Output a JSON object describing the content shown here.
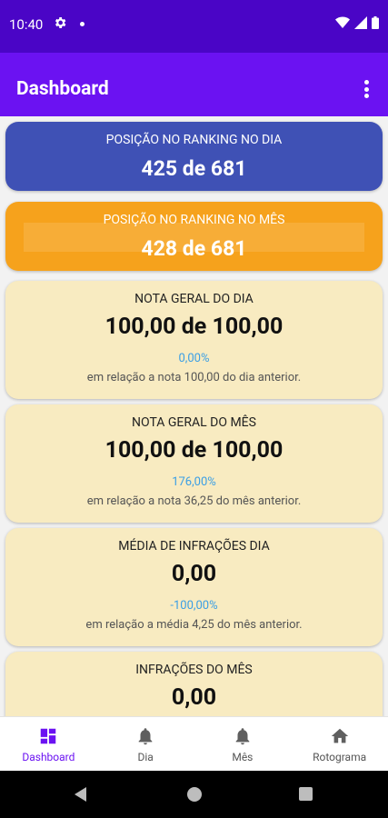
{
  "status_bar": {
    "time": "10:40"
  },
  "app_bar": {
    "title": "Dashboard"
  },
  "ranking_day": {
    "label": "POSIÇÃO NO RANKING NO DIA",
    "value": "425 de 681"
  },
  "ranking_month": {
    "label": "POSIÇÃO NO RANKING NO MÊS",
    "value": "428 de 681"
  },
  "cards": [
    {
      "label": "NOTA GERAL DO DIA",
      "value": "100,00 de 100,00",
      "percent": "0,00%",
      "note": "em relação a nota 100,00 do dia anterior."
    },
    {
      "label": "NOTA GERAL DO MÊS",
      "value": "100,00 de 100,00",
      "percent": "176,00%",
      "note": "em relação a nota 36,25 do mês anterior."
    },
    {
      "label": "MÉDIA DE INFRAÇÕES DIA",
      "value": "0,00",
      "percent": "-100,00%",
      "note": "em relação a média 4,25 do mês anterior."
    },
    {
      "label": "INFRAÇÕES DO MÊS",
      "value": "0,00"
    }
  ],
  "bottom_nav": [
    {
      "label": "Dashboard",
      "icon": "dashboard-icon",
      "active": true
    },
    {
      "label": "Dia",
      "icon": "bell-icon",
      "active": false
    },
    {
      "label": "Mês",
      "icon": "bell-icon",
      "active": false
    },
    {
      "label": "Rotograma",
      "icon": "home-icon",
      "active": false
    }
  ],
  "colors": {
    "status_bar": "#4a05c6",
    "app_bar": "#6b12f2",
    "ranking_day": "#3f51b5",
    "ranking_month": "#f6a21c",
    "card": "#f8ebc1",
    "percent": "#3b9fe5",
    "nav_active": "#6b12f2"
  }
}
